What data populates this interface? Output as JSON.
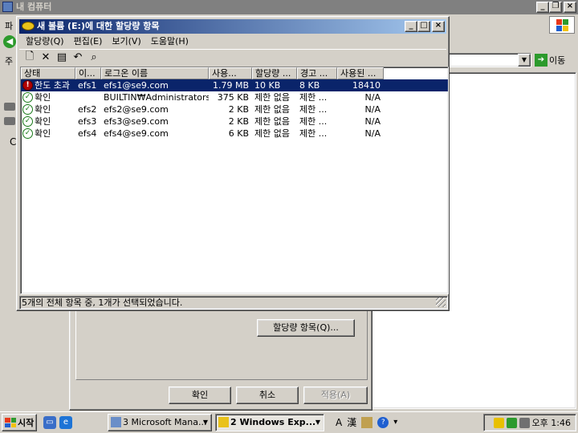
{
  "background_window": {
    "title": "내 컴퓨터",
    "menu_fragment": "파",
    "address_label_fragment": "주",
    "go_label": "이동",
    "left_label_fragment": "C"
  },
  "property_dialog": {
    "quota_entries_label": "할당량 항목(Q)...",
    "ok_label": "확인",
    "cancel_label": "취소",
    "apply_label": "적용(A)"
  },
  "quota_window": {
    "title": "새 볼륨 (E:)에 대한 할당량 항목",
    "menu": [
      "할당량(Q)",
      "편집(E)",
      "보기(V)",
      "도움말(H)"
    ],
    "columns": [
      "상태",
      "이...",
      "로그온 이름",
      "사용...",
      "할당량 ...",
      "경고 ...",
      "사용된 ..."
    ],
    "rows": [
      {
        "status": "한도 초과",
        "icon": "warning",
        "name": "efs1",
        "logon": "efs1@se9.com",
        "used": "1.79 MB",
        "quota": "10 KB",
        "warning": "8 KB",
        "percent": "18410",
        "selected": true
      },
      {
        "status": "확인",
        "icon": "ok",
        "name": "",
        "logon": "BUILTIN₩Administrators",
        "used": "375 KB",
        "quota": "제한 없음",
        "warning": "제한 ...",
        "percent": "N/A",
        "selected": false
      },
      {
        "status": "확인",
        "icon": "ok",
        "name": "efs2",
        "logon": "efs2@se9.com",
        "used": "2 KB",
        "quota": "제한 없음",
        "warning": "제한 ...",
        "percent": "N/A",
        "selected": false
      },
      {
        "status": "확인",
        "icon": "ok",
        "name": "efs3",
        "logon": "efs3@se9.com",
        "used": "2 KB",
        "quota": "제한 없음",
        "warning": "제한 ...",
        "percent": "N/A",
        "selected": false
      },
      {
        "status": "확인",
        "icon": "ok",
        "name": "efs4",
        "logon": "efs4@se9.com",
        "used": "6 KB",
        "quota": "제한 없음",
        "warning": "제한 ...",
        "percent": "N/A",
        "selected": false
      }
    ],
    "status_text": "5개의 전체 항목 중, 1개가 선택되었습니다."
  },
  "taskbar": {
    "start_label": "시작",
    "tasks": [
      "3 Microsoft Mana...",
      "2 Windows Exp..."
    ],
    "ime_a": "A",
    "ime_han": "漢",
    "clock": "오후 1:46"
  },
  "colors": {
    "title_active_start": "#0a246a",
    "title_active_end": "#a6caf0",
    "selection": "#0a246a",
    "face": "#d4d0c8"
  }
}
